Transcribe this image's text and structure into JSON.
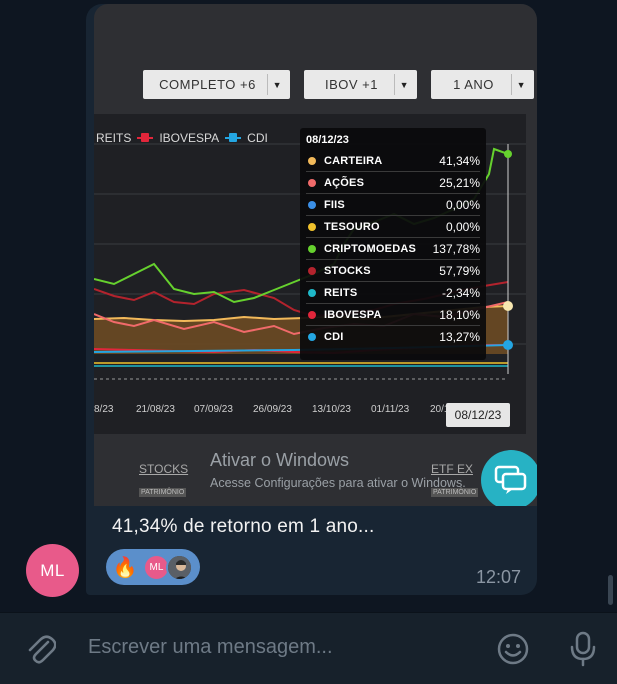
{
  "message": {
    "filters": [
      {
        "label": "COMPLETO +6"
      },
      {
        "label": "IBOV +1"
      },
      {
        "label": "1 ANO"
      }
    ],
    "legend": [
      {
        "name": "REITS",
        "color": "#9aa0a6"
      },
      {
        "name": "IBOVESPA",
        "color": "#e2263b"
      },
      {
        "name": "CDI",
        "color": "#24a6e2"
      }
    ],
    "x_ticks": [
      "8/23",
      "21/08/23",
      "07/09/23",
      "26/09/23",
      "13/10/23",
      "01/11/23",
      "20/1"
    ],
    "x_active": "08/12/23",
    "tooltip": {
      "date": "08/12/23",
      "rows": [
        {
          "name": "CARTEIRA",
          "value": "41,34%",
          "color": "#f2b95a"
        },
        {
          "name": "AÇÕES",
          "value": "25,21%",
          "color": "#f06a6a"
        },
        {
          "name": "FIIS",
          "value": "0,00%",
          "color": "#3b8fe6"
        },
        {
          "name": "TESOURO",
          "value": "0,00%",
          "color": "#f0c22c"
        },
        {
          "name": "CRIPTOMOEDAS",
          "value": "137,78%",
          "color": "#66d12e"
        },
        {
          "name": "STOCKS",
          "value": "57,79%",
          "color": "#b3232d"
        },
        {
          "name": "REITS",
          "value": "-2,34%",
          "color": "#1fb8c8"
        },
        {
          "name": "IBOVESPA",
          "value": "18,10%",
          "color": "#e2263b"
        },
        {
          "name": "CDI",
          "value": "13,27%",
          "color": "#24a6e2"
        }
      ]
    },
    "watermark": {
      "title": "Ativar o Windows",
      "subtitle": "Acesse Configurações para ativar o Windows."
    },
    "ghost": {
      "stocks": "STOCKS",
      "patrimonio": "PATRIMÔNIO",
      "etf": "ETF EX"
    },
    "caption": "41,34% de retorno em 1 ano...",
    "reactions": {
      "emoji": "🔥",
      "avatar_initials": "ML"
    },
    "time": "12:07"
  },
  "sender": {
    "initials": "ML",
    "color": "#e85a8a"
  },
  "composer": {
    "placeholder": "Escrever uma mensagem..."
  },
  "icons": {
    "attach": "paperclip-icon",
    "emoji": "smiley-icon",
    "mic": "microphone-icon",
    "fab": "chat-bubbles-icon"
  }
}
